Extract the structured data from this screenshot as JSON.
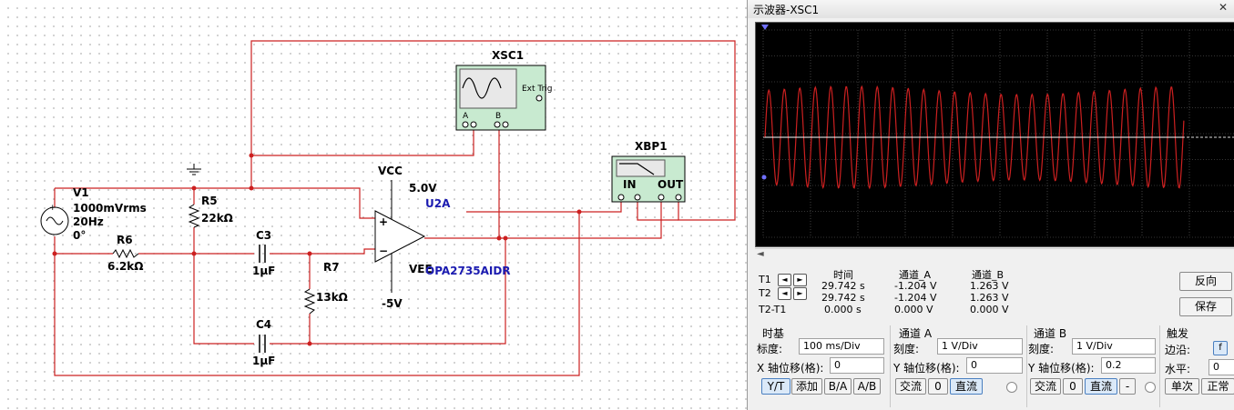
{
  "schematic": {
    "instruments": {
      "oscilloscope": {
        "ref": "XSC1",
        "ext_trig": "Ext Trig",
        "pin_a": "A",
        "pin_b": "B"
      },
      "bode": {
        "ref": "XBP1",
        "in": "IN",
        "out": "OUT"
      }
    },
    "source": {
      "ref": "V1",
      "amplitude": "1000mVrms",
      "freq": "20Hz",
      "phase": "0°"
    },
    "resistors": [
      {
        "ref": "R5",
        "value": "22kΩ"
      },
      {
        "ref": "R6",
        "value": "6.2kΩ"
      },
      {
        "ref": "R7",
        "value": "13kΩ"
      }
    ],
    "capacitors": [
      {
        "ref": "C3",
        "value": "1μF"
      },
      {
        "ref": "C4",
        "value": "1μF"
      }
    ],
    "opamp": {
      "ref": "U2A",
      "part": "OPA2735AIDR",
      "vcc_label": "VCC",
      "vcc_value": "5.0V",
      "vee_label": "VEE",
      "vee_value": "-5V",
      "pin_plus": "+",
      "pin_minus": "−"
    }
  },
  "scope_window": {
    "title": "示波器-XSC1",
    "close": "✕",
    "waveform_color": "#cc2020",
    "screen_bg": "#000000",
    "scroll_left": "◄",
    "measurements": {
      "headers": {
        "time": "时间",
        "channel_a": "通道_A",
        "channel_b": "通道_B"
      },
      "rows": [
        {
          "label": "T1",
          "time": "29.742 s",
          "a": "-1.204 V",
          "b": "1.263 V"
        },
        {
          "label": "T2",
          "time": "29.742 s",
          "a": "-1.204 V",
          "b": "1.263 V"
        },
        {
          "label": "T2-T1",
          "time": "0.000 s",
          "a": "0.000 V",
          "b": "0.000 V"
        }
      ],
      "arrow_left": "◄",
      "arrow_right": "►"
    },
    "buttons": {
      "reverse": "反向",
      "save": "保存"
    },
    "timebase": {
      "title": "时基",
      "scale_label": "标度:",
      "scale_value": "100 ms/Div",
      "xpos_label": "X 轴位移(格):",
      "xpos_value": "0",
      "modes": [
        "Y/T",
        "添加",
        "B/A",
        "A/B"
      ]
    },
    "channel_a": {
      "title": "通道 A",
      "scale_label": "刻度:",
      "scale_value": "1  V/Div",
      "ypos_label": "Y 轴位移(格):",
      "ypos_value": "0",
      "coupling": [
        "交流",
        "0",
        "直流"
      ]
    },
    "channel_b": {
      "title": "通道 B",
      "scale_label": "刻度:",
      "scale_value": "1  V/Div",
      "ypos_label": "Y 轴位移(格):",
      "ypos_value": "0.2",
      "coupling": [
        "交流",
        "0",
        "直流",
        "-"
      ]
    },
    "trigger": {
      "title": "触发",
      "edge_label": "边沿:",
      "edge_value": "f",
      "level_label": "水平:",
      "level_value": "0",
      "modes": [
        "单次",
        "正常"
      ]
    }
  }
}
